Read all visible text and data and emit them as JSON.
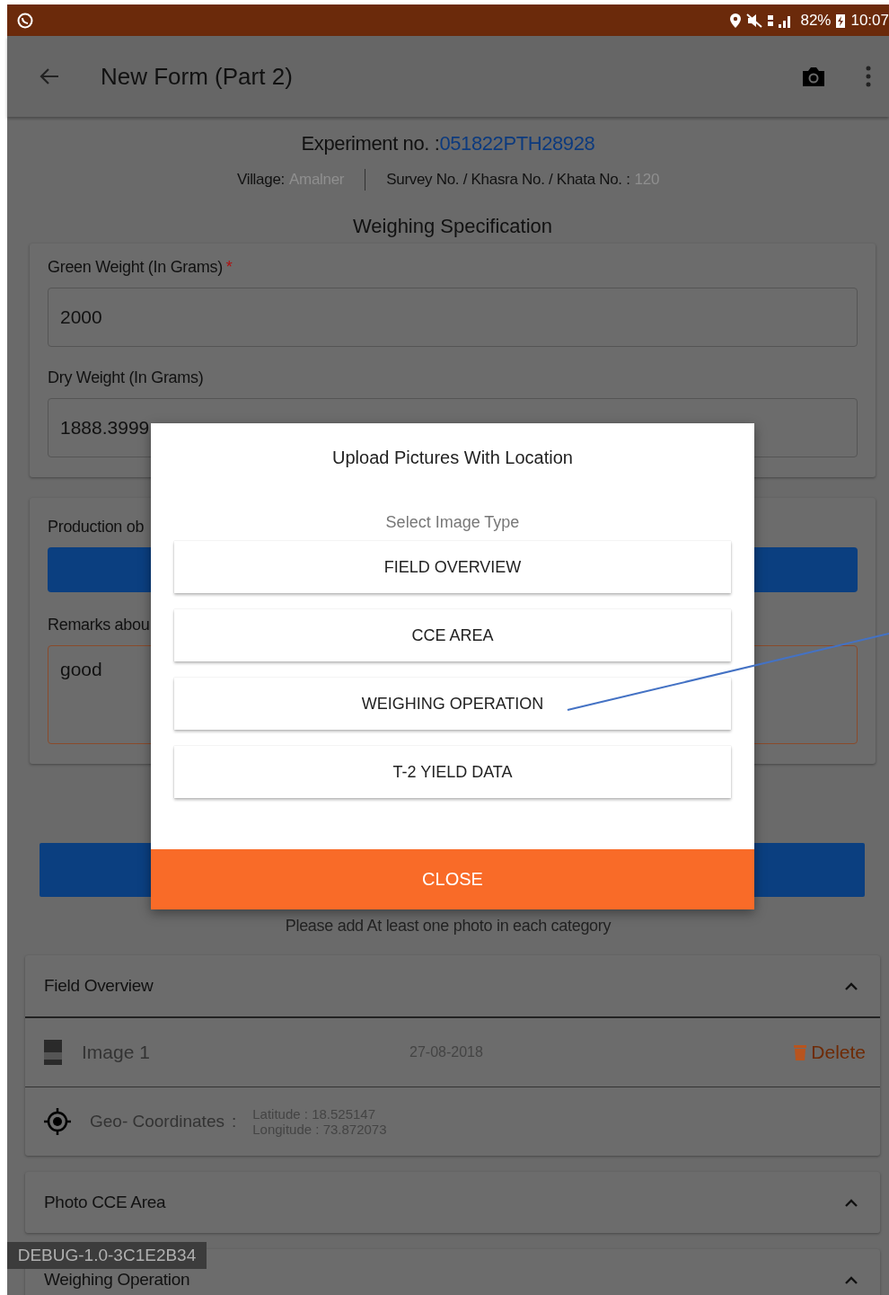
{
  "status_bar": {
    "battery": "82%",
    "time": "10:07"
  },
  "app_bar": {
    "title": "New Form (Part 2)"
  },
  "header": {
    "experiment_label": "Experiment no. :",
    "experiment_no": "051822PTH28928",
    "village_label": "Village:",
    "village": "Amalner",
    "survey_label": "Survey No. / Khasra No. / Khata No. :",
    "survey": "120"
  },
  "section_title": "Weighing Specification",
  "fields": [
    {
      "label": "Green Weight (In Grams)",
      "required_mark": "*",
      "value": "2000"
    },
    {
      "label": "Dry Weight (In Grams)",
      "value": "1888.3999"
    }
  ],
  "production": {
    "label": "Production ob"
  },
  "remarks": {
    "label": "Remarks abou",
    "value": "good"
  },
  "hint": "Please add At least one photo in each category",
  "sections": [
    {
      "title": "Field Overview",
      "expanded": true,
      "images": [
        {
          "name": "Image 1",
          "date": "27-08-2018",
          "delete": "Delete",
          "geo_label": "Geo- Coordinates",
          "geo_sep": ":",
          "latitude": "Latitude : 18.525147",
          "longitude": "Longitude : 73.872073"
        }
      ]
    },
    {
      "title": "Photo CCE Area",
      "expanded": true
    },
    {
      "title": "Weighing Operation",
      "expanded": true
    }
  ],
  "debug_badge": "DEBUG-1.0-3C1E2B34",
  "dialog": {
    "title": "Upload Pictures With Location",
    "subtitle": "Select Image Type",
    "options": [
      "FIELD OVERVIEW",
      "CCE AREA",
      "WEIGHING OPERATION",
      "T-2 YIELD DATA"
    ],
    "close": "CLOSE"
  }
}
